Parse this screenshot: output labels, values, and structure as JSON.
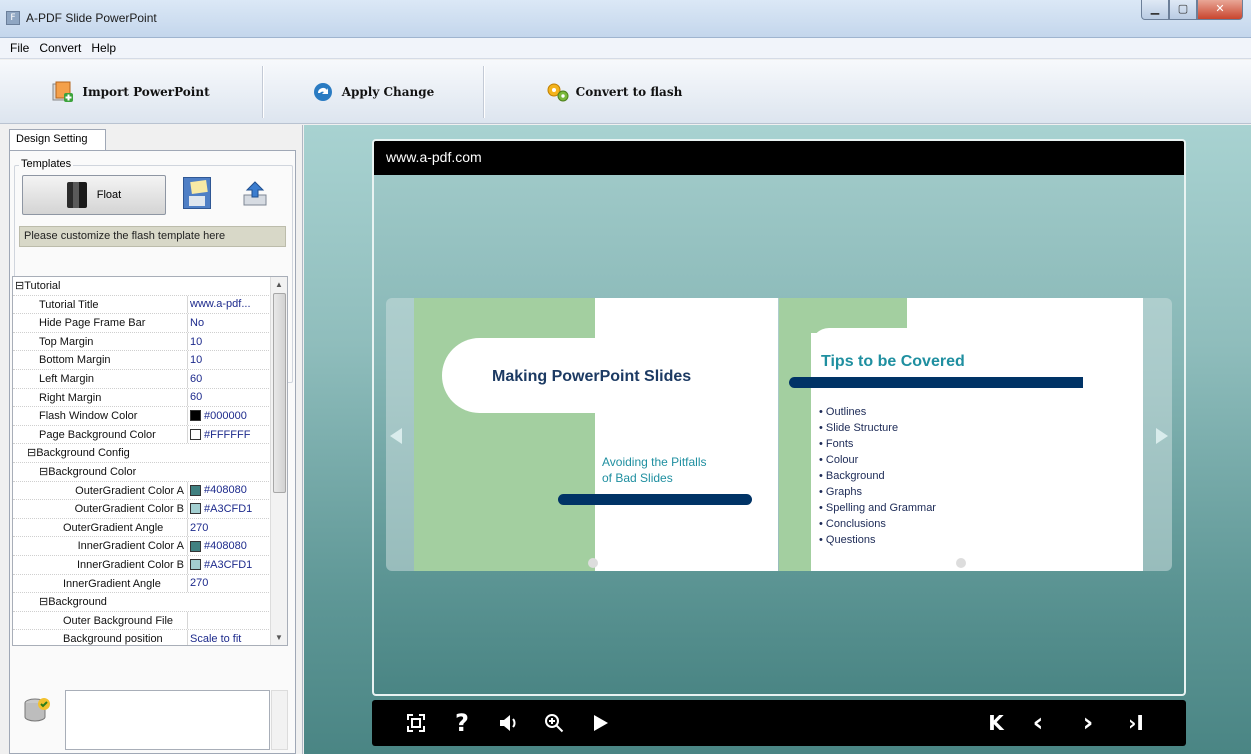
{
  "window": {
    "title": "A-PDF Slide PowerPoint",
    "app_icon": "F"
  },
  "menu": [
    "File",
    "Convert",
    "Help"
  ],
  "toolbar": {
    "import_label": "Import PowerPoint",
    "apply_label": "Apply Change",
    "convert_label": "Convert to flash"
  },
  "left": {
    "tab_label": "Design Setting",
    "templates_label": "Templates",
    "float_label": "Float",
    "hint": "Please customize the flash template here"
  },
  "props": [
    {
      "name": "⊟Tutorial",
      "value": "",
      "indent": 0,
      "cat": true
    },
    {
      "name": "Tutorial Title",
      "value": "www.a-pdf...",
      "indent": 1
    },
    {
      "name": "Hide Page Frame Bar",
      "value": "No",
      "indent": 1
    },
    {
      "name": "Top Margin",
      "value": "10",
      "indent": 1
    },
    {
      "name": "Bottom Margin",
      "value": "10",
      "indent": 1
    },
    {
      "name": "Left Margin",
      "value": "60",
      "indent": 1
    },
    {
      "name": "Right Margin",
      "value": "60",
      "indent": 1
    },
    {
      "name": "Flash Window Color",
      "value": "#000000",
      "swatch": "#000000",
      "indent": 1
    },
    {
      "name": "Page Background Color",
      "value": "#FFFFFF",
      "swatch": "#FFFFFF",
      "indent": 1
    },
    {
      "name": "⊟Background Config",
      "value": "",
      "indent": 1,
      "cat": true
    },
    {
      "name": "⊟Background Color",
      "value": "",
      "indent": 2,
      "cat": true
    },
    {
      "name": "OuterGradient Color A",
      "value": "#408080",
      "swatch": "#408080",
      "indent": 3,
      "right": true
    },
    {
      "name": "OuterGradient Color B",
      "value": "#A3CFD1",
      "swatch": "#A3CFD1",
      "indent": 3,
      "right": true
    },
    {
      "name": "OuterGradient Angle",
      "value": "270",
      "indent": 3
    },
    {
      "name": "InnerGradient Color A",
      "value": "#408080",
      "swatch": "#408080",
      "indent": 3,
      "right": true
    },
    {
      "name": "InnerGradient Color B",
      "value": "#A3CFD1",
      "swatch": "#A3CFD1",
      "indent": 3,
      "right": true
    },
    {
      "name": "InnerGradient Angle",
      "value": "270",
      "indent": 3
    },
    {
      "name": "⊟Background",
      "value": "",
      "indent": 2,
      "cat": true
    },
    {
      "name": "Outer Background File",
      "value": "",
      "indent": 3
    },
    {
      "name": "Background position",
      "value": "Scale to fit",
      "indent": 3
    }
  ],
  "viewer": {
    "frame_title": "www.a-pdf.com",
    "slide1": {
      "title": "Making PowerPoint Slides",
      "subtitle1": "Avoiding the Pitfalls",
      "subtitle2": "of Bad Slides"
    },
    "slide2": {
      "title": "Tips to be Covered",
      "bullets": [
        "Outlines",
        "Slide Structure",
        "Fonts",
        "Colour",
        "Background",
        "Graphs",
        "Spelling and Grammar",
        "Conclusions",
        "Questions"
      ]
    }
  },
  "controls": {
    "fit_icon": "fit-screen-icon",
    "help_glyph": "?",
    "first_glyph": "K",
    "prev_glyph": "‹",
    "next_glyph": "›",
    "last_glyph": "›I"
  },
  "colors": {
    "accent_blue": "#003366",
    "teal_text": "#1f8fa0",
    "slide_green": "#a3cfa0"
  }
}
